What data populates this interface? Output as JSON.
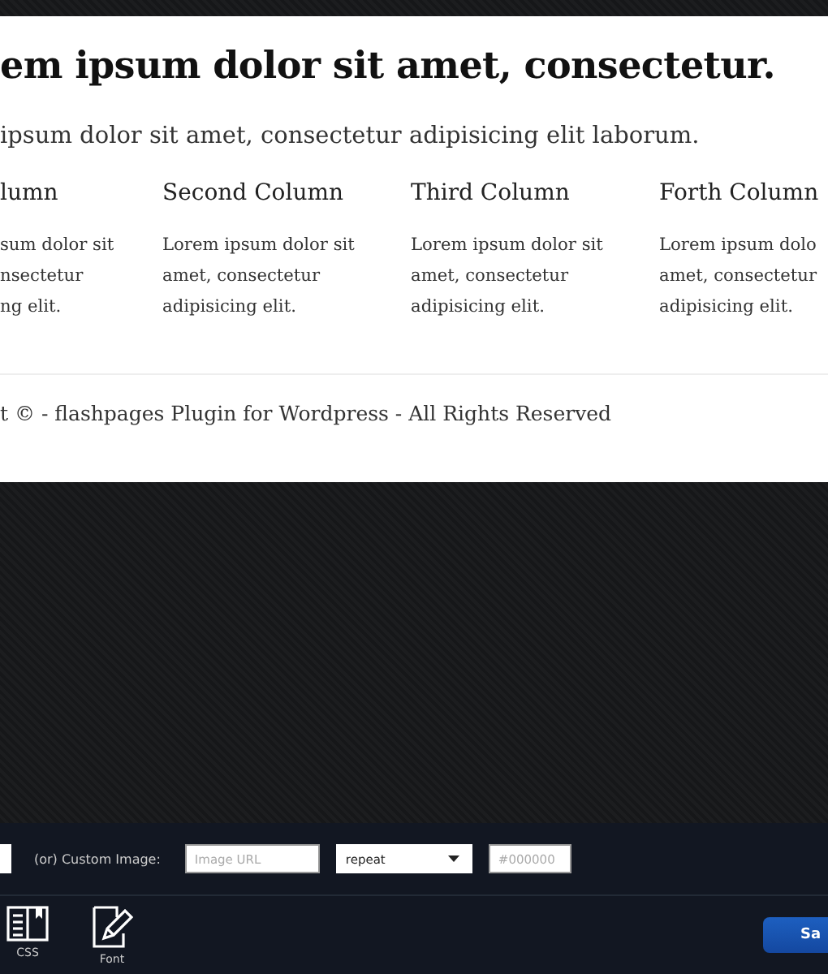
{
  "page": {
    "heading": "em ipsum dolor sit amet, consectetur.",
    "intro": "ipsum dolor sit amet, consectetur adipisicing elit laborum.",
    "columns": [
      {
        "title": "lumn",
        "lines": [
          "sum dolor sit",
          "nsectetur",
          "ng elit."
        ]
      },
      {
        "title": "Second Column",
        "lines": [
          "Lorem ipsum dolor sit",
          "amet, consectetur",
          "adipisicing elit."
        ]
      },
      {
        "title": "Third Column",
        "lines": [
          "Lorem ipsum dolor sit",
          "amet, consectetur",
          "adipisicing elit."
        ]
      },
      {
        "title": "Forth Column",
        "lines": [
          "Lorem ipsum dolo",
          "amet, consectetur",
          "adipisicing elit."
        ]
      }
    ],
    "footer": "t © - flashpages Plugin for Wordpress - All Rights Reserved"
  },
  "background_bar": {
    "custom_image_label": "(or) Custom Image:",
    "image_url": {
      "placeholder": "Image URL"
    },
    "repeat_select": "repeat",
    "color_field": {
      "placeholder": "#000000"
    }
  },
  "tools": [
    {
      "kind": "css",
      "label": "CSS"
    },
    {
      "kind": "font",
      "label": "Font"
    }
  ],
  "save_button": "Sa"
}
